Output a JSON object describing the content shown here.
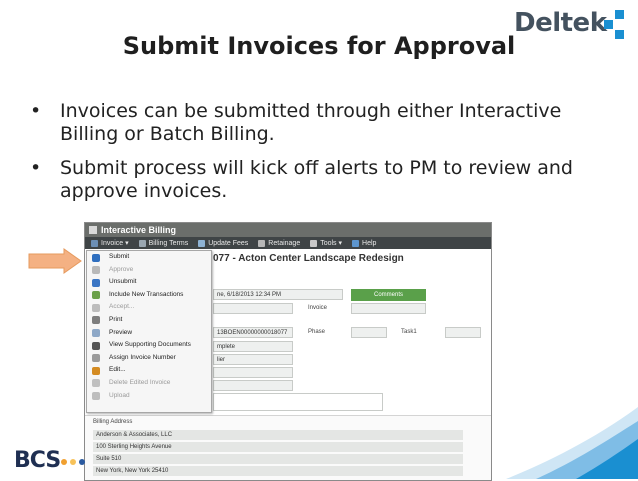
{
  "logo": {
    "text": "Deltek"
  },
  "slide": {
    "title": "Submit Invoices for Approval",
    "bullets": [
      "Invoices can be submitted through either Interactive Billing or Batch Billing.",
      "Submit process will kick off alerts to PM to review and approve invoices."
    ],
    "bullet_char": "•"
  },
  "screenshot": {
    "window_title": "Interactive Billing",
    "menubar": [
      {
        "label": "Invoice ▾",
        "icon": "invoice-icon",
        "color": "#6c8fb5"
      },
      {
        "label": "Billing Terms",
        "icon": "billing-terms-icon",
        "color": "#9aa7b1"
      },
      {
        "label": "Update Fees",
        "icon": "update-fees-icon",
        "color": "#8fb3d4"
      },
      {
        "label": "Retainage",
        "icon": "retainage-icon",
        "color": "#b7b7b7"
      },
      {
        "label": "Tools ▾",
        "icon": "tools-icon",
        "color": "#c9c9c9"
      },
      {
        "label": "Help",
        "icon": "help-icon",
        "color": "#5d96cf"
      }
    ],
    "doc_header": "077 - Acton Center Landscape Redesign",
    "date_field": "ne, 6/18/2013 12:34 PM",
    "comments_label": "Comments",
    "invoice_label": "Invoice",
    "id_field": "13BOEN00000000018077",
    "phase_label": "Phase",
    "task_label": "Task1",
    "status_field": "mplete",
    "approver_field": "lier",
    "invoice_menu": [
      {
        "label": "Submit",
        "enabled": true,
        "icon": "submit-icon",
        "color": "#2f6fbf"
      },
      {
        "label": "Approve",
        "enabled": false,
        "icon": "approve-icon",
        "color": "#b9b9b9"
      },
      {
        "label": "Unsubmit",
        "enabled": true,
        "icon": "unsubmit-icon",
        "color": "#3a75c4"
      },
      {
        "label": "Include New Transactions",
        "enabled": true,
        "icon": "include-transactions-icon",
        "color": "#6ba04a"
      },
      {
        "label": "Accept...",
        "enabled": false,
        "icon": "accept-icon",
        "color": "#bcbcbc"
      },
      {
        "label": "Print",
        "enabled": true,
        "icon": "print-icon",
        "color": "#7d7d7d"
      },
      {
        "label": "Preview",
        "enabled": true,
        "icon": "preview-icon",
        "color": "#8ea8c7"
      },
      {
        "label": "View Supporting Documents",
        "enabled": true,
        "icon": "view-documents-icon",
        "color": "#555555"
      },
      {
        "label": "Assign Invoice Number",
        "enabled": true,
        "icon": "assign-number-icon",
        "color": "#9b9b9b"
      },
      {
        "label": "Edit...",
        "enabled": true,
        "icon": "edit-icon",
        "color": "#d48b22"
      },
      {
        "label": "Delete Edited Invoice",
        "enabled": false,
        "icon": "delete-icon",
        "color": "#c0c0c0"
      },
      {
        "label": "Upload",
        "enabled": false,
        "icon": "upload-icon",
        "color": "#bdbdbd"
      }
    ],
    "billing_address": {
      "title": "Billing Address",
      "lines": [
        "Anderson & Associates, LLC",
        "100 Sterling Heights Avenue",
        "Suite 510",
        "New York, New York  25410"
      ]
    }
  },
  "footer": {
    "bcs_text": "BCS"
  },
  "colors": {
    "accent_blue": "#1a8fd1",
    "arrow_fill": "#f4b183",
    "arrow_stroke": "#e69a5e",
    "bcs_dot_1": "#f0a030",
    "bcs_dot_2": "#f7c25a",
    "bcs_dot_3": "#2a5aa0"
  }
}
